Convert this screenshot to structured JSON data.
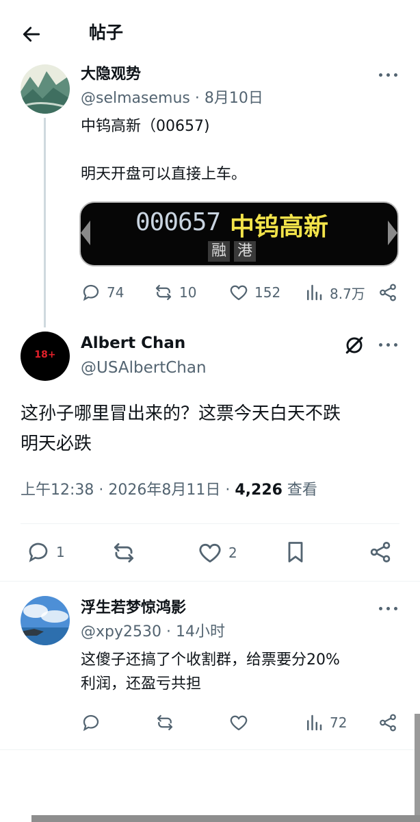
{
  "header": {
    "title": "帖子"
  },
  "post1": {
    "name": "大隐观势",
    "handle": "@selmasemus",
    "date": "8月10日",
    "line1": "中钨高新（00657)",
    "line2": "明天开盘可以直接上车。",
    "card": {
      "code": "000657",
      "stock_name": "中钨高新",
      "tag1": "融",
      "tag2": "港"
    },
    "stats": {
      "replies": "74",
      "reposts": "10",
      "likes": "152",
      "views": "8.7万"
    }
  },
  "post2": {
    "name": "Albert Chan",
    "handle": "@USAlbertChan",
    "avatar_text": "18+",
    "text_line1": "这孙子哪里冒出来的？这票今天白天不跌",
    "text_line2": "明天必跌",
    "time": "上午12:38 · 2026年8月11日 · ",
    "views": "4,226",
    "views_label": " 查看",
    "stats": {
      "replies": "1",
      "likes": "2"
    }
  },
  "reply1": {
    "name": "浮生若梦惊鸿影",
    "handle": "@xpy2530",
    "time": "14小时",
    "line1": "这傻子还搞了个收割群，给票要分20%",
    "line2": "利润，还盈亏共担",
    "stats": {
      "views": "72"
    }
  },
  "colors": {
    "text": "#0f1419",
    "muted": "#536471",
    "divider": "#eff3f4",
    "card_yellow": "#f2e34a"
  }
}
